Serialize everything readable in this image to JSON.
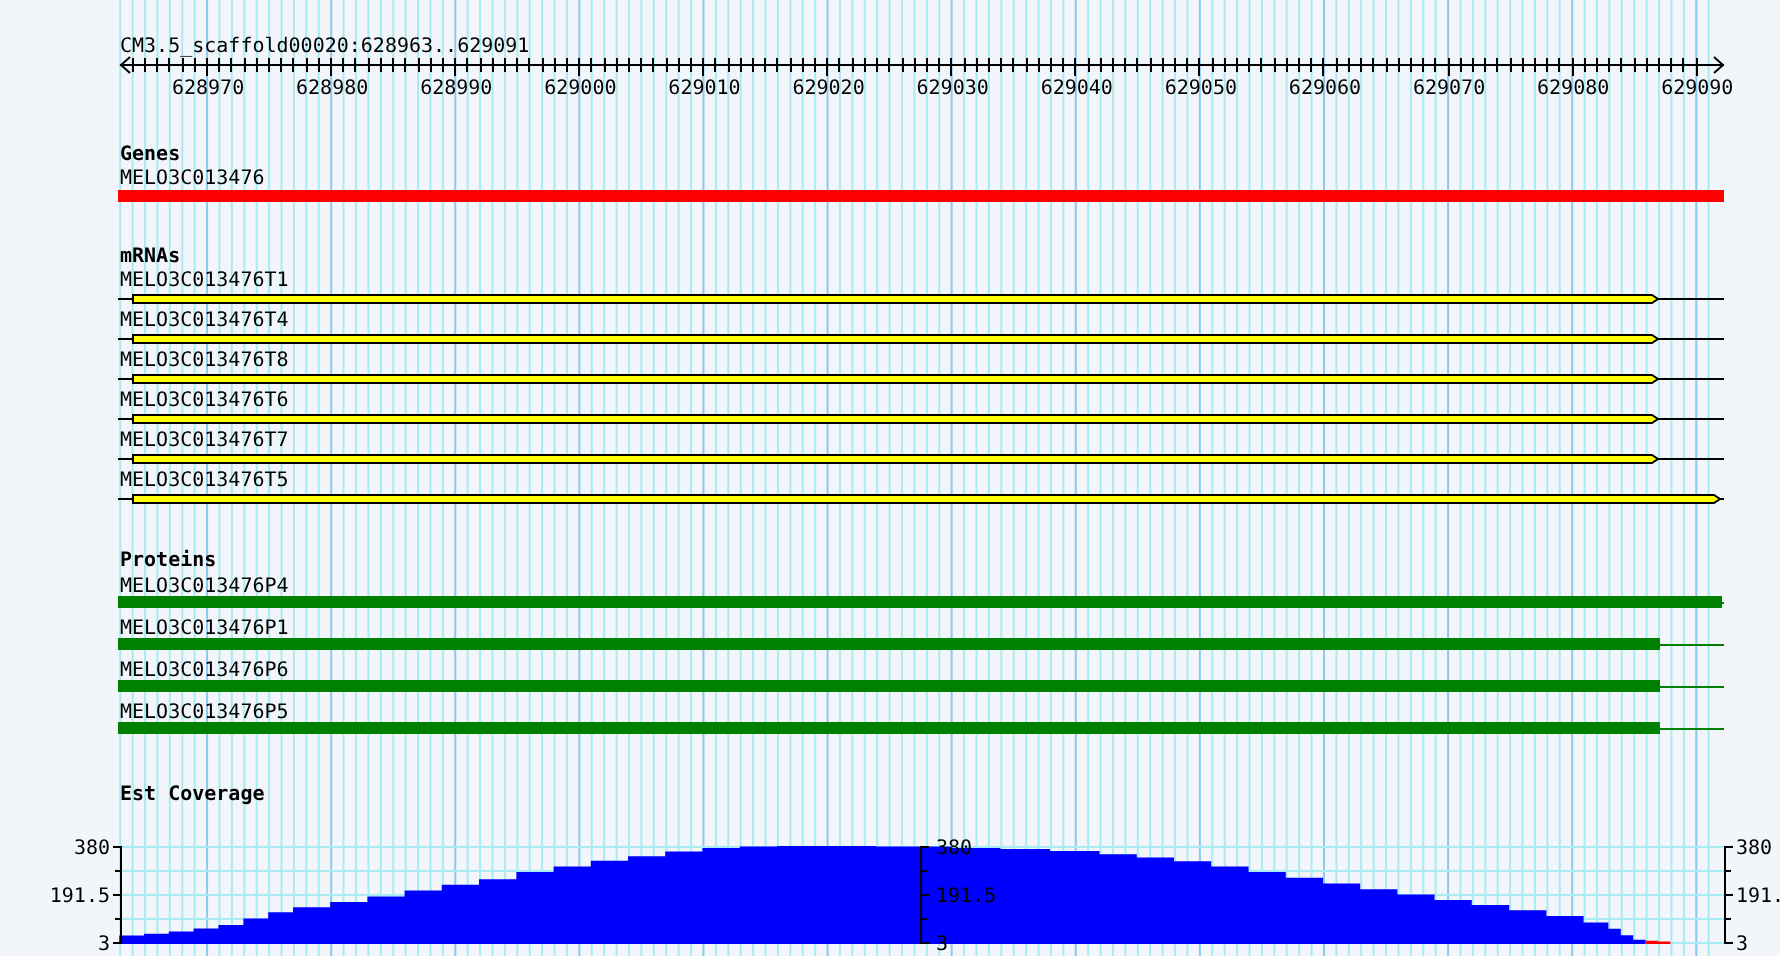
{
  "ruler": {
    "label": "CM3.5_scaffold00020:628963..629091",
    "ticks": [
      "628970",
      "628980",
      "628990",
      "629000",
      "629010",
      "629020",
      "629030",
      "629040",
      "629050",
      "629060",
      "629070",
      "629080",
      "629090"
    ]
  },
  "tracks": [
    {
      "kind": "genes",
      "title": "Genes",
      "color": "#ff0000",
      "features": [
        {
          "name": "MELO3C013476",
          "kind": "full"
        }
      ]
    },
    {
      "kind": "mrnas",
      "title": "mRNAs",
      "color": "#ffff00",
      "features": [
        {
          "name": "MELO3C013476T1",
          "kind": "partial"
        },
        {
          "name": "MELO3C013476T4",
          "kind": "partial"
        },
        {
          "name": "MELO3C013476T8",
          "kind": "partial"
        },
        {
          "name": "MELO3C013476T6",
          "kind": "partial"
        },
        {
          "name": "MELO3C013476T7",
          "kind": "partial"
        },
        {
          "name": "MELO3C013476T5",
          "kind": "full"
        }
      ]
    },
    {
      "kind": "proteins",
      "title": "Proteins",
      "color": "#008000",
      "features": [
        {
          "name": "MELO3C013476P4",
          "kind": "full"
        },
        {
          "name": "MELO3C013476P1",
          "kind": "partial"
        },
        {
          "name": "MELO3C013476P6",
          "kind": "partial"
        },
        {
          "name": "MELO3C013476P5",
          "kind": "partial"
        }
      ]
    },
    {
      "kind": "coverage",
      "title": "Est Coverage",
      "axes": [
        {
          "labels": [
            "380",
            "191.5",
            "3"
          ]
        },
        {
          "labels": [
            "380",
            "191.5",
            "3"
          ]
        },
        {
          "labels": [
            "380",
            "191.",
            "3"
          ]
        }
      ]
    }
  ]
}
